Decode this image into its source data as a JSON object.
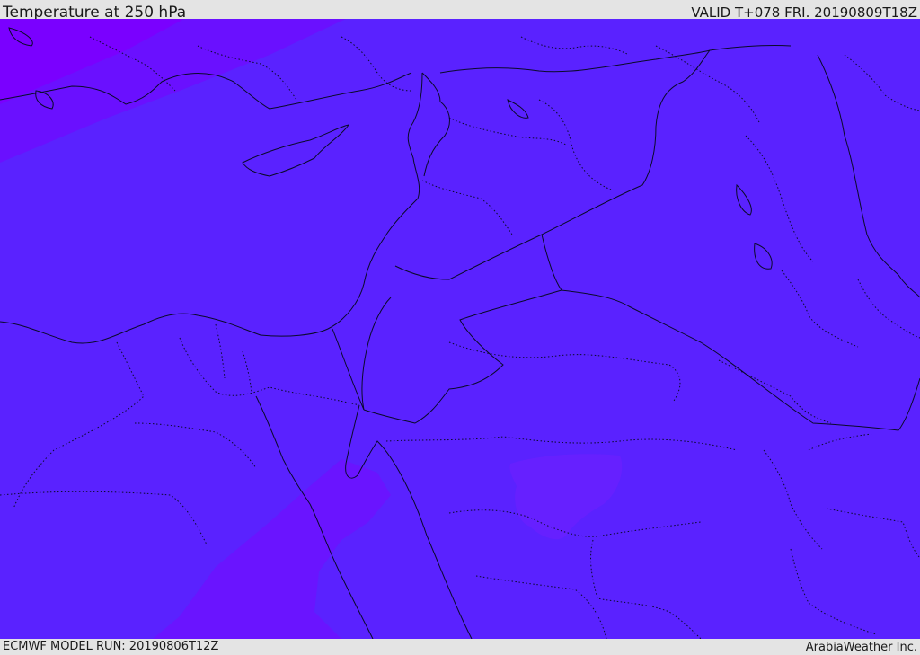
{
  "header": {
    "title": "Temperature at 250 hPa",
    "valid": "VALID T+078 FRI. 20190809T18Z"
  },
  "footer": {
    "model_run": "ECMWF MODEL RUN: 20190806T12Z",
    "credit": "ArabiaWeather Inc."
  },
  "map": {
    "colors": {
      "base_field": "#5a22ff",
      "cool_band_outer": "#7a00ff",
      "cool_band_inner": "#6a10ff",
      "south_band": "#6a14ff",
      "inland_patch": "#6620ff",
      "borders": "#0a0a2a"
    }
  }
}
